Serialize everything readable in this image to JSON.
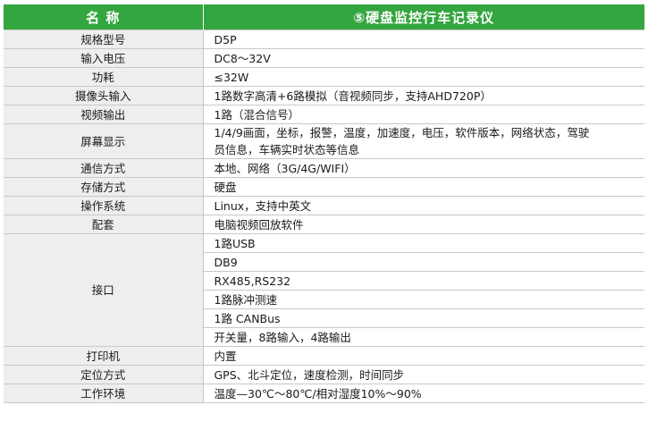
{
  "header": {
    "col1": "名 称",
    "col2": "⑤硬盘监控行车记录仪"
  },
  "rows": [
    {
      "label": "规格型号",
      "value": "D5P"
    },
    {
      "label": "输入电压",
      "value": "DC8～32V"
    },
    {
      "label": "功耗",
      "value": "≤32W"
    },
    {
      "label": "摄像头输入",
      "value": "1路数字高清+6路模拟（音视频同步，支持AHD720P）"
    },
    {
      "label": "视频输出",
      "value": "1路（混合信号）"
    },
    {
      "label": "屏幕显示",
      "value": "1/4/9画面，坐标，报警，温度，加速度，电压，软件版本，网络状态，驾驶员信息，车辆实时状态等信息"
    },
    {
      "label": "通信方式",
      "value": "本地、网络（3G/4G/WIFI）"
    },
    {
      "label": "存储方式",
      "value": "硬盘"
    },
    {
      "label": "操作系统",
      "value": "Linux，支持中英文"
    },
    {
      "label": "配套",
      "value": "电脑视频回放软件"
    }
  ],
  "interface": {
    "label": "接口",
    "items": [
      "1路USB",
      "DB9",
      "RX485,RS232",
      "1路脉冲测速",
      "1路 CANBus",
      "开关量，8路输入，4路输出"
    ]
  },
  "tail_rows": [
    {
      "label": "打印机",
      "value": "内置"
    },
    {
      "label": "定位方式",
      "value": "GPS、北斗定位，速度检测，时间同步"
    },
    {
      "label": "工作环境",
      "value": "温度—30℃～80℃/相对湿度10%～90%"
    }
  ],
  "colors": {
    "header_bg": "#34a63f",
    "label_bg": "#eeeeee",
    "border": "#c8c8c8"
  }
}
